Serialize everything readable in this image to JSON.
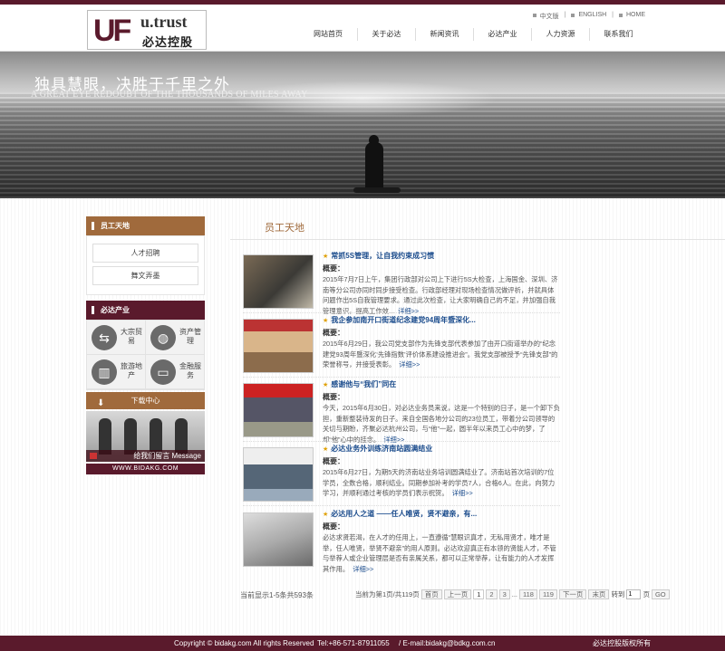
{
  "header": {
    "logo_mark": "UF",
    "logo_en": "u.trust",
    "logo_cn": "必达控股",
    "lang": [
      "中文版",
      "ENGLISH",
      "HOME"
    ],
    "nav": [
      "网站首页",
      "关于必达",
      "新闻资讯",
      "必达产业",
      "人力资源",
      "联系我们"
    ]
  },
  "banner": {
    "title_cn": "独具慧眼，决胜于千里之外",
    "title_en": "A GREAT EYE REDOUBT OF THE THOUSANDS OF MILES AWAY"
  },
  "sidebar": {
    "section1_title": "员工天地",
    "links": [
      "人才招聘",
      "舞文弄墨"
    ],
    "section2_title": "必达产业",
    "business": [
      {
        "label": "大宗贸易",
        "icon": "trade-icon"
      },
      {
        "label": "资产管理",
        "icon": "globe-icon"
      },
      {
        "label": "旅游地产",
        "icon": "building-icon"
      },
      {
        "label": "金融服务",
        "icon": "card-icon"
      }
    ],
    "download": "下载中心",
    "message": "给我们留言 Message",
    "url": "WWW.BIDAKG.COM"
  },
  "main": {
    "title": "员工天地",
    "label": "概要：",
    "more": "详细>>",
    "articles": [
      {
        "title": "常抓5S管理，让自我约束成习惯",
        "body": "2015年7月7日上午，集团行政部对公司上下进行5S大检查，上海国金、深圳、济南等分公司亦同时同步接受检查。行政部经理对现场检查情况做评析，并就具体问题作出5S自我管理要求。通过此次检查，让大家明确自己的不足，并加强自我管理意识，提高工作效..."
      },
      {
        "title": "我企参加南开口街道纪念建党94周年暨深化...",
        "body": "2015年6月29日，我公司党支部作为先锋支部代表参加了由开口街道举办的“纪念建党93周年暨深化‘先锋指数’评价体系建设推进会”。我党支部被授予“先锋支部”的荣誉称号，并接受表彰。"
      },
      {
        "title": "感谢他与“我们”同在",
        "body": "今天，2015年6月30日，对必达业务员来说，这是一个特别的日子，是一个卸下负担，重新整装待发的日子。来自全国各地分公司的23位员工，带着分公司领导的关切与期盼，齐聚必达杭州公司，与“他”一起，圆半年以来员工心中的梦，了却“他”心中的挂念。"
      },
      {
        "title": "必达业务外训练济南站圆满结业",
        "body": "2015年6月27日，为期5天的济南站业务培训圆满结业了。济南站首次培训的7位学员，全数合格，顺利结业。同期参加补考的学员7人，合格6人。在此，向努力学习，并顺利通过考核的学员们表示祝贺。"
      },
      {
        "title": "必达用人之道 ——任人唯贤，贤不避亲，有...",
        "body": "必达求贤若渴，在人才的任用上，一直遵循“慧眼识真才，无私用贤才，唯才是举，任人唯贤，举贤不避亲”的用人原则。必达欢迎真正有本领的贤能人才，不管与举荐人或企业管理层是否有亲属关系，都可以正常举荐，让有能力的人才发挥其作用。"
      }
    ]
  },
  "paging": {
    "summary": "当前显示1-5条共593条",
    "page_info": "当前为第1页/共119页",
    "first": "首页",
    "prev": "上一页",
    "pages": [
      "1",
      "2",
      "3",
      "...",
      "118",
      "119"
    ],
    "next": "下一页",
    "last": "末页",
    "goto_label": "转到",
    "goto_value": "1",
    "page_unit": "页",
    "go": "GO"
  },
  "footer": {
    "copyright": "Copyright © bidakg.com All rights Reserved",
    "tel": "Tel:+86-571-87911055",
    "email": "/ E-mail:bidakg@bdkg.com.cn",
    "rights": "必达控股版权所有"
  },
  "colors": {
    "brand": "#5a1a2c",
    "accent": "#a06a3c",
    "link": "#1a4b8c"
  }
}
